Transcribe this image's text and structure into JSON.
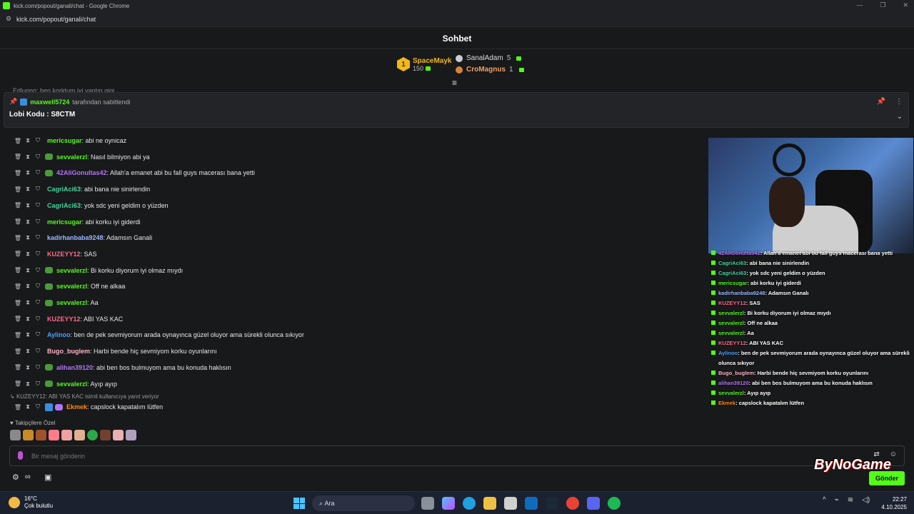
{
  "window": {
    "title": "kick.com/popout/ganali/chat - Google Chrome",
    "url": "kick.com/popout/ganali/chat"
  },
  "header": {
    "title": "Sohbet"
  },
  "leaderboard": {
    "first": {
      "rank": "1",
      "name": "SpaceMayk",
      "count": "150"
    },
    "second": {
      "name": "SanalAdam",
      "count": "5"
    },
    "third": {
      "name": "CroMagnus",
      "count": "1"
    }
  },
  "ghost_line": "Edlunno: ben korktum iyi yaptın gigi",
  "pinned": {
    "user": "maxwell5724",
    "suffix": "tarafından sabitlendi",
    "text": "Lobi Kodu : S8CTM"
  },
  "messages": [
    {
      "user": "mericsugar",
      "text": ": abi ne oynicaz",
      "color": "#53fc18",
      "emoji": false
    },
    {
      "user": "sevvalerzl",
      "text": ": Nasıl bilmiyon abi ya",
      "color": "#53fc18",
      "emoji": true
    },
    {
      "user": "42AliGonultas42",
      "text": ": Allah'a emanet abi bu fall guys macerası bana yetti",
      "color": "#b473f5",
      "emoji": true
    },
    {
      "user": "CagriAci63",
      "text": ": abi bana nie sinirlendin",
      "color": "#45d4a0",
      "emoji": false
    },
    {
      "user": "CagriAci63",
      "text": ": yok sdc yeni geldim o yüzden",
      "color": "#45d4a0",
      "emoji": false
    },
    {
      "user": "mericsugar",
      "text": ": abi korku iyi giderdi",
      "color": "#53fc18",
      "emoji": false
    },
    {
      "user": "kadirhanbaba9248",
      "text": ": Adamsın Ganali",
      "color": "#9ab8ff",
      "emoji": false
    },
    {
      "user": "KUZEYY12",
      "text": ": SAS",
      "color": "#ff6b8b",
      "emoji": false
    },
    {
      "user": "sevvalerzl",
      "text": ": Bi korku diyorum iyi olmaz mıydı",
      "color": "#53fc18",
      "emoji": true
    },
    {
      "user": "sevvalerzl",
      "text": ": Off ne alkaa",
      "color": "#53fc18",
      "emoji": true
    },
    {
      "user": "sevvalerzl",
      "text": ": Aa",
      "color": "#53fc18",
      "emoji": true
    },
    {
      "user": "KUZEYY12",
      "text": ": ABI YAS KAC",
      "color": "#ff6b8b",
      "emoji": false
    },
    {
      "user": "Aylinoo",
      "text": ": ben de pek sevmiyorum arada oynayınca güzel oluyor ama sürekli olunca sıkıyor",
      "color": "#4aa3ff",
      "emoji": false
    },
    {
      "user": "Bugo_buglem",
      "text": ": Harbi bende hiç sevmiyom korku oyunlarını",
      "color": "#ffb3c7",
      "emoji": false
    },
    {
      "user": "alihan39120",
      "text": ": abi ben bos bulmuyom ama bu konuda haklısın",
      "color": "#b473f5",
      "emoji": true
    },
    {
      "user": "sevvalerzl",
      "text": ": Ayıp ayıp",
      "color": "#53fc18",
      "emoji": true
    }
  ],
  "reply_hint": "KUZEYY12: ABI YAS KAC isimli kullanıcıya yanıt veriyor",
  "last_message": {
    "user": "Ekmek",
    "text": ": capslock kapatalım lütfen",
    "color": "#ff8c1a"
  },
  "overlay_messages": [
    {
      "user": "42AliGonultas42",
      "text": " : Allah'a emanet abi bu fall guys macerası bana yetti",
      "color": "#b473f5"
    },
    {
      "user": "CagriAci63",
      "text": " : abi bana nie sinirlendin",
      "color": "#45d4a0"
    },
    {
      "user": "CagriAci63",
      "text": " : yok sdc yeni geldim o yüzden",
      "color": "#45d4a0"
    },
    {
      "user": "mericsugar",
      "text": " : abi korku iyi giderdi",
      "color": "#53fc18"
    },
    {
      "user": "kadirhanbaba9248",
      "text": " : Adamsın Ganalı",
      "color": "#9ab8ff"
    },
    {
      "user": "KUZEYY12",
      "text": " : SAS",
      "color": "#ff6b8b"
    },
    {
      "user": "sevvalerzl",
      "text": " : Bi korku diyorum iyi olmaz mıydı",
      "color": "#53fc18"
    },
    {
      "user": "sevvalerzl",
      "text": " : Off ne alkaa",
      "color": "#53fc18"
    },
    {
      "user": "sevvalerzl",
      "text": " : Aa",
      "color": "#53fc18"
    },
    {
      "user": "KUZEYY12",
      "text": " : ABI YAS KAC",
      "color": "#ff6b8b"
    },
    {
      "user": "Aylinoo",
      "text": " : ben de pek sevmiyorum arada oynayınca güzel oluyor ama sürekli",
      "color": "#4aa3ff"
    },
    {
      "user": "",
      "text": "olunca sıkıyor",
      "color": "#ffffff"
    },
    {
      "user": "Bugo_buglem",
      "text": " : Harbi bende hiç sevmiyom korku oyunlarını",
      "color": "#ffb3c7"
    },
    {
      "user": "alihan39120",
      "text": " : abi ben bos bulmuyom ama bu konuda haklısın",
      "color": "#b473f5"
    },
    {
      "user": "sevvalerzl",
      "text": " : Ayıp ayıp",
      "color": "#53fc18"
    },
    {
      "user": "Ekmek",
      "text": " : capslock kapatalım lütfen",
      "color": "#ff8c1a"
    }
  ],
  "followers_label": "Takipçilere Özel",
  "composer": {
    "placeholder": "Bir mesaj gönderin",
    "send": "Gönder"
  },
  "watermark": "ByNoGame",
  "taskbar": {
    "temp": "16°C",
    "weather": "Çok bulutlu",
    "search": "Ara",
    "time": "22:27",
    "date": "4.10.2025"
  },
  "colors": {
    "accent": "#53fc18",
    "bg": "#18191b"
  }
}
